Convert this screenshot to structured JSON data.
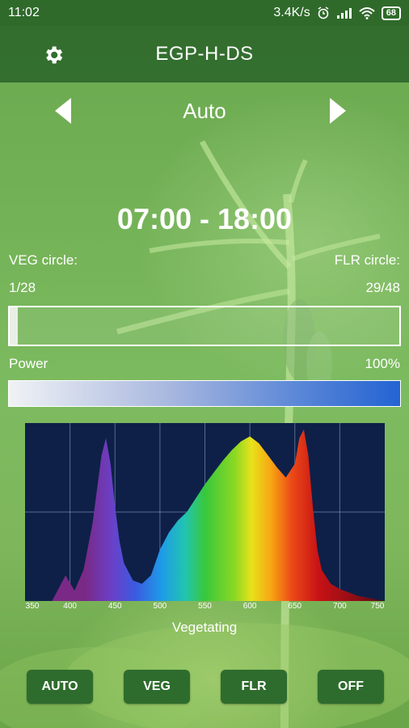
{
  "status_bar": {
    "time": "11:02",
    "network_speed": "3.4K/s",
    "alarm_icon": "alarm-clock-icon",
    "signal_icon": "cell-signal-icon",
    "wifi_icon": "wifi-icon",
    "battery": "68"
  },
  "app_bar": {
    "title": "EGP-H-DS",
    "settings_icon": "gear-icon"
  },
  "mode_selector": {
    "current": "Auto",
    "prev_icon": "triangle-left-icon",
    "next_icon": "triangle-right-icon"
  },
  "schedule": {
    "time_range": "07:00 - 18:00"
  },
  "cycle": {
    "veg_label": "VEG circle:",
    "flr_label": "FLR circle:",
    "veg_count": "1/28",
    "flr_count": "29/48",
    "progress_fraction": 0.02
  },
  "power": {
    "label": "Power",
    "value": "100%"
  },
  "chart_data": {
    "type": "area",
    "xlabel": "",
    "ylabel": "",
    "x_ticks": [
      "350",
      "400",
      "450",
      "500",
      "550",
      "600",
      "650",
      "700",
      "750"
    ],
    "xlim": [
      350,
      750
    ],
    "ylim": [
      0,
      1
    ],
    "grid": true,
    "x": [
      380,
      395,
      405,
      415,
      425,
      435,
      440,
      445,
      450,
      455,
      460,
      470,
      480,
      490,
      500,
      510,
      520,
      530,
      540,
      550,
      560,
      570,
      580,
      590,
      600,
      610,
      620,
      630,
      640,
      650,
      655,
      660,
      665,
      670,
      675,
      680,
      690,
      700,
      710,
      720,
      730,
      740,
      750
    ],
    "values": [
      0.0,
      0.15,
      0.06,
      0.18,
      0.45,
      0.85,
      0.95,
      0.8,
      0.55,
      0.35,
      0.22,
      0.12,
      0.1,
      0.15,
      0.3,
      0.4,
      0.47,
      0.52,
      0.6,
      0.68,
      0.75,
      0.82,
      0.88,
      0.93,
      0.96,
      0.92,
      0.85,
      0.78,
      0.72,
      0.8,
      0.95,
      1.0,
      0.85,
      0.55,
      0.3,
      0.18,
      0.1,
      0.07,
      0.05,
      0.03,
      0.02,
      0.01,
      0.0
    ]
  },
  "spectrum": {
    "caption": "Vegetating"
  },
  "buttons": {
    "auto": "AUTO",
    "veg": "VEG",
    "flr": "FLR",
    "off": "OFF"
  }
}
